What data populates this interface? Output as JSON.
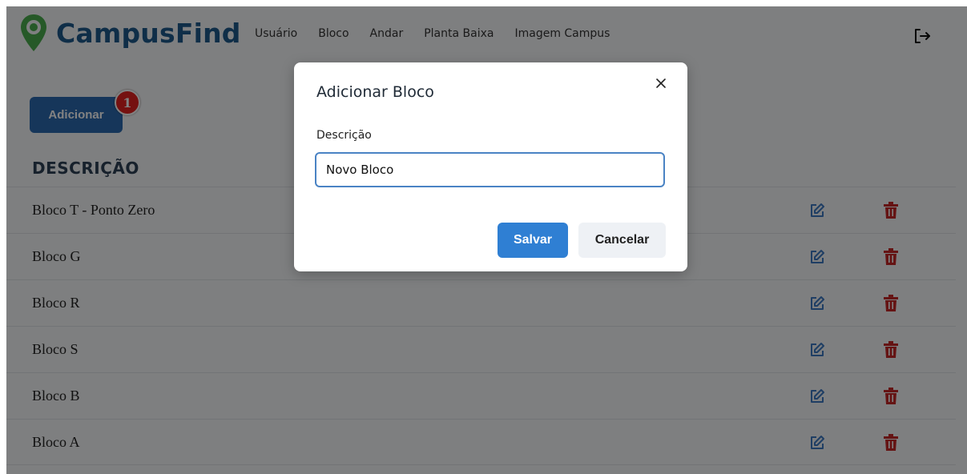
{
  "header": {
    "logo_text": "CampusFind",
    "nav": [
      "Usuário",
      "Bloco",
      "Andar",
      "Planta Baixa",
      "Imagem Campus"
    ]
  },
  "toolbar": {
    "add_label": "Adicionar",
    "badge": "1"
  },
  "table": {
    "column_header": "DESCRIÇÃO",
    "rows": [
      "Bloco T - Ponto Zero",
      "Bloco G",
      "Bloco R",
      "Bloco S",
      "Bloco B",
      "Bloco A"
    ]
  },
  "modal": {
    "title": "Adicionar Bloco",
    "field_label": "Descrição",
    "field_value": "Novo Bloco",
    "save_label": "Salvar",
    "cancel_label": "Cancelar"
  },
  "colors": {
    "brand": "#1f5a8e",
    "logo_green": "#4caf50",
    "primary_button": "#2f7fd3",
    "delete_red": "#c62828",
    "edit_blue": "#3d7bc4"
  }
}
